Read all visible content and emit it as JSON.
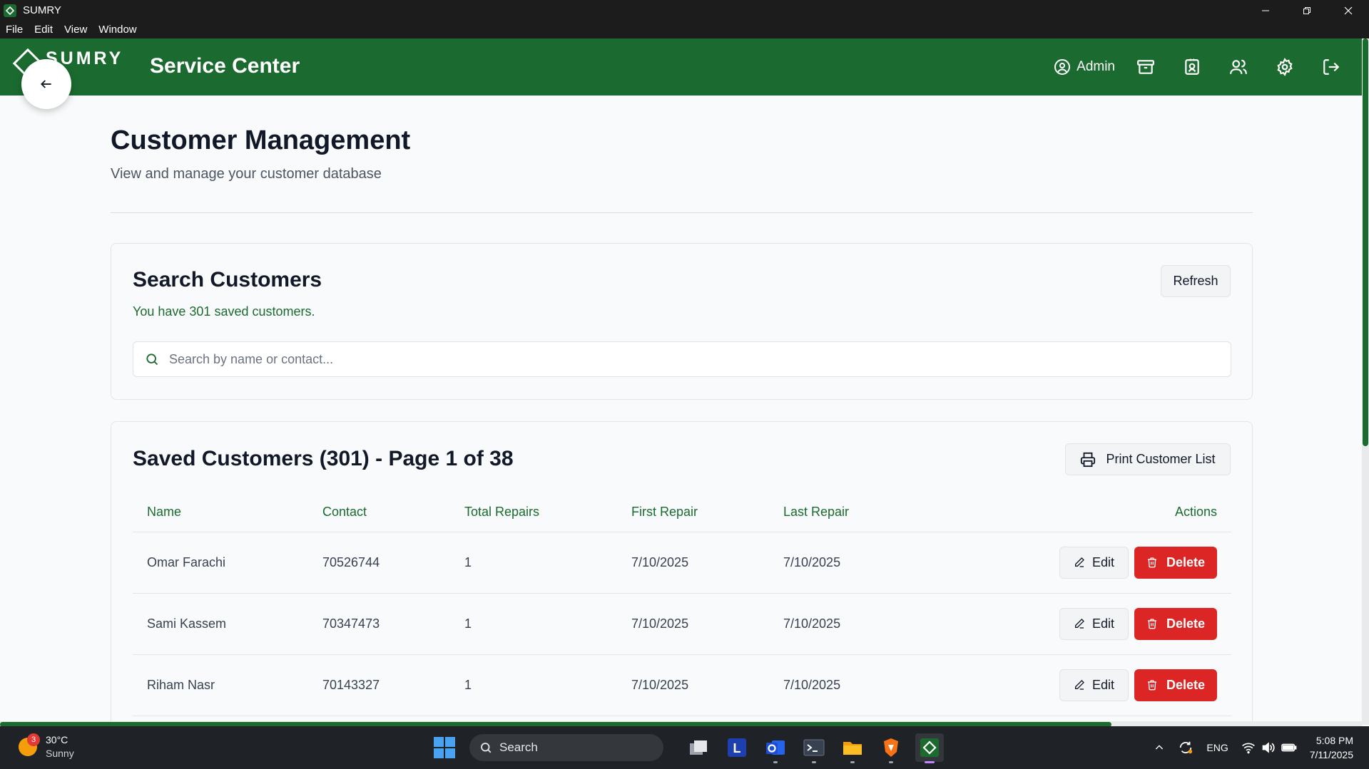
{
  "window": {
    "title": "SUMRY",
    "menu": [
      "File",
      "Edit",
      "View",
      "Window"
    ]
  },
  "header": {
    "logo_text": "SUMRY",
    "title": "Service Center",
    "admin_label": "Admin",
    "icons": [
      "archive-icon",
      "contact-card-icon",
      "users-icon",
      "settings-icon",
      "logout-icon"
    ]
  },
  "page": {
    "title": "Customer Management",
    "subtitle": "View and manage your customer database"
  },
  "search_card": {
    "title": "Search Customers",
    "count_text": "You have 301 saved customers.",
    "refresh_label": "Refresh",
    "search_placeholder": "Search by name or contact...",
    "search_value": ""
  },
  "table_card": {
    "title": "Saved Customers (301) - Page 1 of 38",
    "print_label": "Print Customer List",
    "columns": [
      "Name",
      "Contact",
      "Total Repairs",
      "First Repair",
      "Last Repair",
      "Actions"
    ],
    "rows": [
      {
        "name": "Omar Farachi",
        "contact": "70526744",
        "total_repairs": "1",
        "first_repair": "7/10/2025",
        "last_repair": "7/10/2025"
      },
      {
        "name": "Sami Kassem",
        "contact": "70347473",
        "total_repairs": "1",
        "first_repair": "7/10/2025",
        "last_repair": "7/10/2025"
      },
      {
        "name": "Riham Nasr",
        "contact": "70143327",
        "total_repairs": "1",
        "first_repair": "7/10/2025",
        "last_repair": "7/10/2025"
      }
    ],
    "edit_label": "Edit",
    "delete_label": "Delete"
  },
  "taskbar": {
    "weather_temp": "30°C",
    "weather_cond": "Sunny",
    "weather_badge": "3",
    "search_label": "Search",
    "language": "ENG",
    "time": "5:08 PM",
    "date": "7/11/2025"
  },
  "colors": {
    "brand_green": "#1b6b30",
    "delete_red": "#dc2626"
  }
}
